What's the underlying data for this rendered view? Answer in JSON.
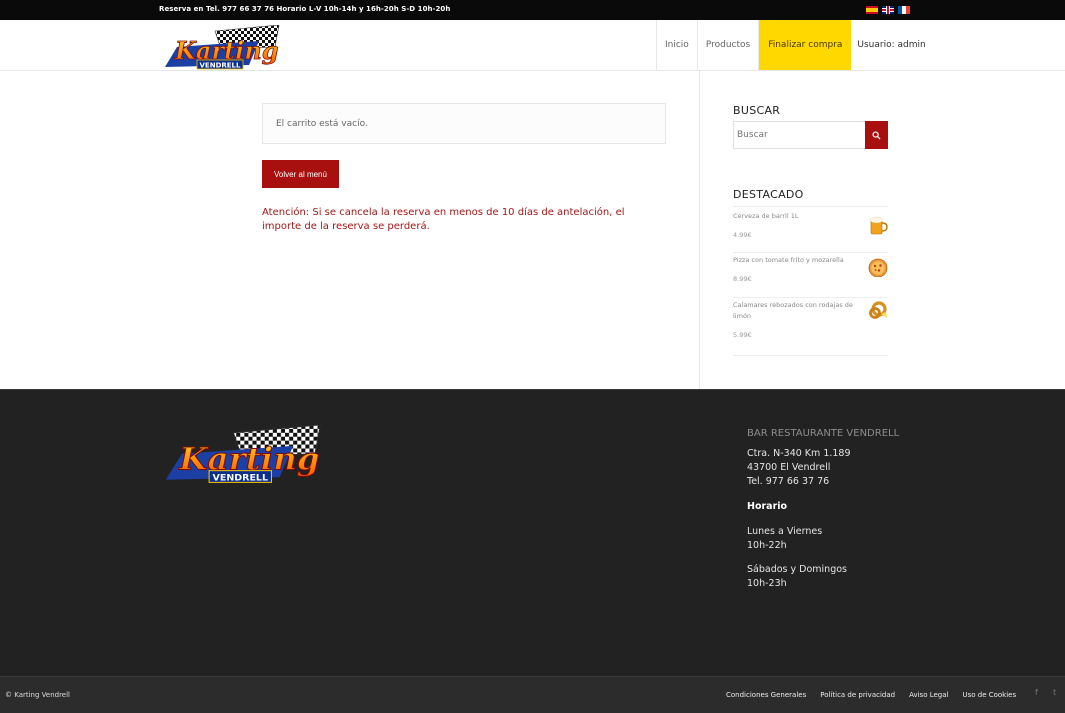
{
  "topbar": {
    "text": "Reserva en Tel. 977 66 37 76 Horario L-V 10h-14h y 16h-20h S-D 10h-20h",
    "flags": [
      "es-flag-icon",
      "uk-flag-icon",
      "fr-flag-icon"
    ]
  },
  "header": {
    "logo_text": "Karting",
    "logo_subtext": "VENDRELL",
    "nav": {
      "inicio": "Inicio",
      "productos": "Productos",
      "finalizar": "Finalizar compra",
      "usuario": "Usuario: admin"
    }
  },
  "main": {
    "cart_empty": "El carrito está vacío.",
    "back_button": "Volver al menú",
    "warning": "Atención: Si se cancela la reserva en menos de 10 días de antelación, el importe de la reserva se perderá."
  },
  "sidebar": {
    "search_title": "BUSCAR",
    "search_placeholder": "Buscar",
    "featured_title": "DESTACADO",
    "products": [
      {
        "name": "Cerveza de barril 1L",
        "price": "4.99€",
        "icon": "beer-icon"
      },
      {
        "name": "Pizza con tomate frito y mozarella",
        "price": "8.99€",
        "icon": "pizza-icon"
      },
      {
        "name": "Calamares rebozados con rodajas de limón",
        "price": "5.99€",
        "icon": "calamari-icon"
      }
    ]
  },
  "footer": {
    "title": "BAR RESTAURANTE VENDRELL",
    "address1": "Ctra. N-340 Km 1.189",
    "address2": "43700 El Vendrell",
    "phone": "Tel. 977 66 37 76",
    "horario_label": "Horario",
    "weekdays_label": "Lunes a Viernes",
    "weekdays_hours": "10h-22h",
    "weekend_label": "Sábados y Domingos",
    "weekend_hours": "10h-23h"
  },
  "bottombar": {
    "copyright": "© Karting Vendrell",
    "links": [
      "Condiciones Generales",
      "Política de privacidad",
      "Aviso Legal",
      "Uso de Cookies"
    ],
    "social": [
      "f",
      "t"
    ]
  },
  "colors": {
    "accent_red": "#a81010",
    "active_nav_yellow": "#ffd800",
    "footer_bg": "#222222"
  }
}
